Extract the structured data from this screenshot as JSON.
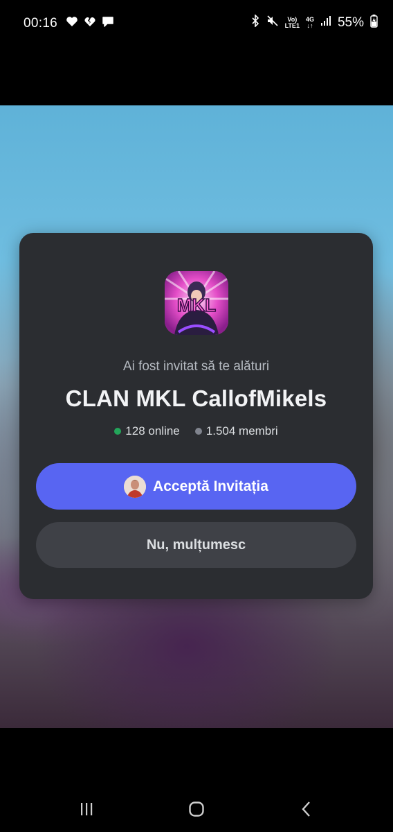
{
  "status_bar": {
    "time": "00:16",
    "battery_percent": "55%",
    "net_top": "4G",
    "volte_top": "Vo)",
    "volte_bottom": "LTE1"
  },
  "invite": {
    "subtitle": "Ai fost invitat să te alături",
    "server_name": "CLAN MKL CallofMikels",
    "online_count": "128 online",
    "member_count": "1.504 membri",
    "accept_label": "Acceptă Invitația",
    "decline_label": "Nu, mulțumesc",
    "icon_text": "MKL"
  },
  "colors": {
    "accent": "#5865f2",
    "card": "#2b2d31",
    "online": "#23a55a",
    "members": "#80848e"
  },
  "icons": {
    "status_left": [
      "heart-icon",
      "broken-heart-icon",
      "chat-bubble-icon"
    ],
    "status_right": [
      "bluetooth-icon",
      "mute-icon",
      "signal-icon",
      "battery-charging-icon"
    ],
    "nav": [
      "recent-apps-icon",
      "home-icon",
      "back-icon"
    ]
  }
}
